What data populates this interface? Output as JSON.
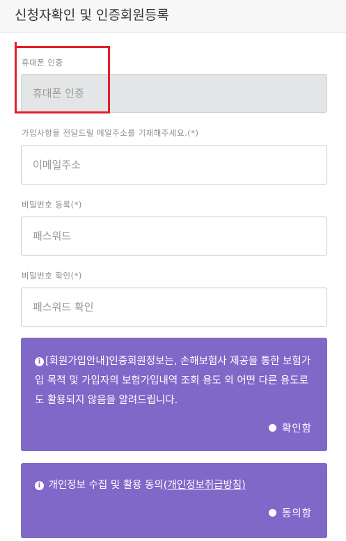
{
  "header": {
    "title": "신청자확인 및 인증회원등록"
  },
  "fields": {
    "phone": {
      "label": "휴대폰 인증",
      "placeholder": "휴대폰 인증"
    },
    "email": {
      "label": "가입사항을 전달드릴 메일주소를 기재해주세요.(*)",
      "placeholder": "이메일주소"
    },
    "password": {
      "label": "비밀번호 등록(*)",
      "placeholder": "패스워드"
    },
    "password_confirm": {
      "label": "비밀번호 확인(*)",
      "placeholder": "패스워드 확인"
    }
  },
  "notice": {
    "info_icon": "i",
    "text": "[회원가입안내]인증회원정보는, 손해보험사 제공을 통한 보험가입 목적 및 가입자의 보험가입내역 조회 용도 외 어떤 다른 용도로도 활용되지 않음을 알려드립니다.",
    "confirm_label": "확인함"
  },
  "consent": {
    "info_icon": "i",
    "text": "개인정보 수집 및 활용 동의",
    "link_text": "(개인정보취급방침)",
    "agree_label": "동의함"
  },
  "colors": {
    "accent_purple": "#8068c9",
    "highlight_red": "#e0202a",
    "header_bg": "#f7f7f8",
    "disabled_input_bg": "#e4e5e6"
  },
  "icons": {
    "info": "info-circle-icon",
    "confirm": "radio-dot-icon"
  }
}
